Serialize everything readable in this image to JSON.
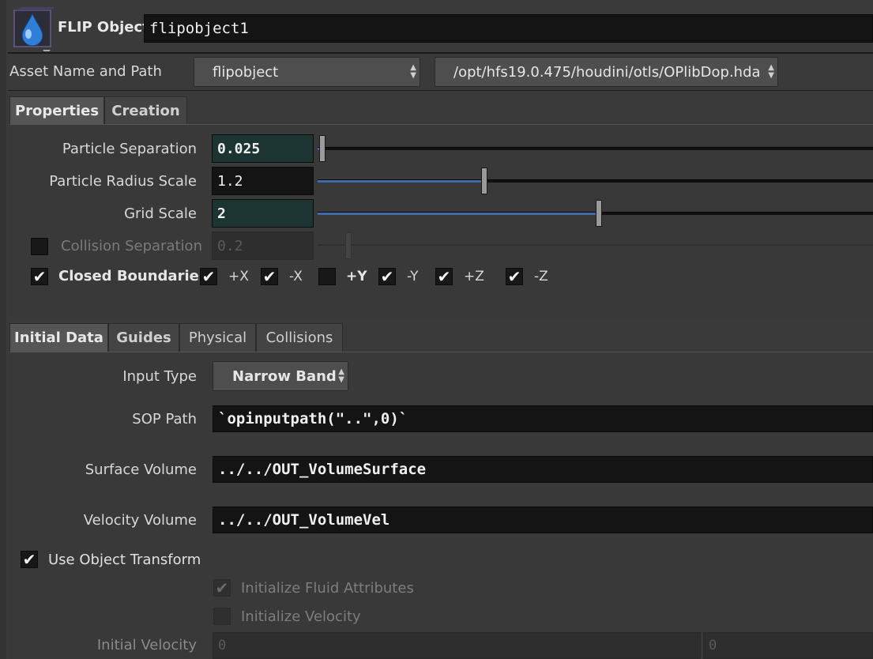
{
  "header": {
    "node_type": "FLIP Object",
    "node_name": "flipobject1",
    "icon": "flip-object-drop-icon"
  },
  "asset": {
    "label": "Asset Name and Path",
    "name": "flipobject",
    "path": "/opt/hfs19.0.475/houdini/otls/OPlibDop.hda"
  },
  "tabs_top": [
    {
      "label": "Properties"
    },
    {
      "label": "Creation"
    }
  ],
  "properties": {
    "particle_separation": {
      "label": "Particle Separation",
      "value": "0.025",
      "slider": 0.003
    },
    "particle_radius_scale": {
      "label": "Particle Radius Scale",
      "value": "1.2",
      "slider": 0.295
    },
    "grid_scale": {
      "label": "Grid Scale",
      "value": "2",
      "slider": 0.5
    },
    "collision_separation": {
      "label": "Collision Separation",
      "value": "0.2",
      "enabled": false,
      "slider": 0.05
    },
    "closed_boundaries": {
      "label": "Closed Boundaries",
      "checked": true
    },
    "axes": [
      {
        "label": "+X",
        "checked": true
      },
      {
        "label": "-X",
        "checked": true
      },
      {
        "label": "+Y",
        "checked": false
      },
      {
        "label": "-Y",
        "checked": true
      },
      {
        "label": "+Z",
        "checked": true
      },
      {
        "label": "-Z",
        "checked": true
      }
    ]
  },
  "tabs_bottom": [
    {
      "label": "Initial Data"
    },
    {
      "label": "Guides"
    },
    {
      "label": "Physical"
    },
    {
      "label": "Collisions"
    }
  ],
  "initial_data": {
    "input_type": {
      "label": "Input Type",
      "value": "Narrow Band"
    },
    "sop_path": {
      "label": "SOP Path",
      "value": "`opinputpath(\"..\",0)`"
    },
    "surface_volume": {
      "label": "Surface Volume",
      "value": "../../OUT_VolumeSurface"
    },
    "velocity_volume": {
      "label": "Velocity Volume",
      "value": "../../OUT_VolumeVel"
    },
    "use_object_transform": {
      "label": "Use Object Transform",
      "checked": true
    },
    "initialize_fluid_attributes": {
      "label": "Initialize Fluid Attributes",
      "checked": true,
      "enabled": false
    },
    "initialize_velocity": {
      "label": "Initialize Velocity",
      "checked": false,
      "enabled": false
    },
    "initial_velocity": {
      "label": "Initial Velocity",
      "x": "0",
      "y": "0"
    }
  },
  "check_glyph": "✔",
  "colors": {
    "background": "#3a3a3a",
    "field": "#141414",
    "field_highlight": "#1c3532",
    "slider_fill": "#3d6aa8"
  }
}
